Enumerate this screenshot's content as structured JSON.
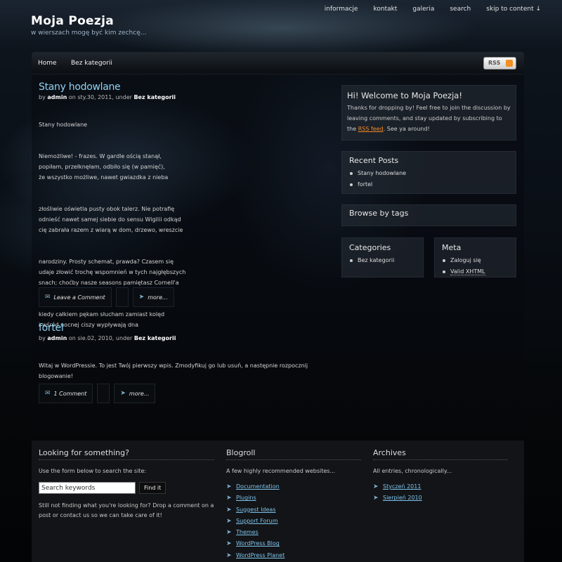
{
  "site": {
    "title": "Moja Poezja",
    "tagline": "w wierszach mogę być kim zechcę..."
  },
  "top_nav": [
    "informacje",
    "kontakt",
    "galeria",
    "search",
    "skip to content ↓"
  ],
  "nav": {
    "home": "Home",
    "category": "Bez kategorii",
    "rss": "RSS"
  },
  "posts": [
    {
      "title": "Stany hodowlane",
      "meta_by": "by",
      "author": "admin",
      "meta_on": "on sty.30, 2011, under",
      "category": "Bez kategorii",
      "body": [
        "Stany hodowlane",
        "Niemożliwe! - frazes. W gardle ością stanął,\npopiłam, przełknęłam, odbiło się (w pamięć),\nże wszystko możliwe, nawet gwiazdka z nieba",
        "złośliwie oświetla pusty obok talerz. Nie potrafię\nodnieść nawet samej siebie do sensu Wigilii odkąd\ncię zabrała razem z wiarą w dom, drzewo, wreszcie",
        "narodziny. Prosty schemat, prawda? Czasem się\nudaje złowić trochę wspomnień w tych najgłębszych\nsnach; choćby nasze seasons pamiętasz Cornell'a",
        "kiedy całkiem pękam słucham zamiast kolęd\ni wśród nocnej ciszy wypływają dna"
      ],
      "comment_label": "Leave a Comment",
      "more_label": "more..."
    },
    {
      "title": "fortel",
      "meta_by": "by",
      "author": "admin",
      "meta_on": "on sie.02, 2010, under",
      "category": "Bez kategorii",
      "body": [
        "Witaj w WordPressie. To jest Twój pierwszy wpis. Zmodyfikuj go lub usuń, a następnie rozpocznij\nblogowanie!"
      ],
      "comment_label": "1 Comment",
      "more_label": "more..."
    }
  ],
  "sidebar": {
    "welcome": {
      "title": "Hi! Welcome to Moja Poezja!",
      "text_before": "Thanks for dropping by! Feel free to join the discussion by leaving comments, and stay updated by subscribing to the",
      "rss_link": "RSS feed",
      "text_after": ". See ya around!"
    },
    "recent_posts": {
      "title": "Recent Posts",
      "items": [
        "Stany hodowlane",
        "fortel"
      ]
    },
    "tags": {
      "title": "Browse by tags"
    },
    "categories": {
      "title": "Categories",
      "items": [
        "Bez kategorii"
      ]
    },
    "meta": {
      "title": "Meta",
      "items": [
        "Zaloguj się",
        "Valid XHTML"
      ]
    }
  },
  "footer": {
    "search": {
      "title": "Looking for something?",
      "intro": "Use the form below to search the site:",
      "placeholder": "Search keywords",
      "button": "Find it",
      "outro": "Still not finding what you're looking for? Drop a comment on a post or contact us so we can take care of it!"
    },
    "blogroll": {
      "title": "Blogroll",
      "intro": "A few highly recommended websites...",
      "items": [
        "Documentation",
        "Plugins",
        "Suggest Ideas",
        "Support Forum",
        "Themes",
        "WordPress Blog",
        "WordPress Planet"
      ]
    },
    "archives": {
      "title": "Archives",
      "intro": "All entries, chronologically...",
      "items": [
        "Styczeń 2011",
        "Sierpień 2010"
      ]
    }
  },
  "colors": {
    "accent": "#8fd3f5",
    "rss": "#f08a24",
    "link": "#7fc3ea"
  }
}
